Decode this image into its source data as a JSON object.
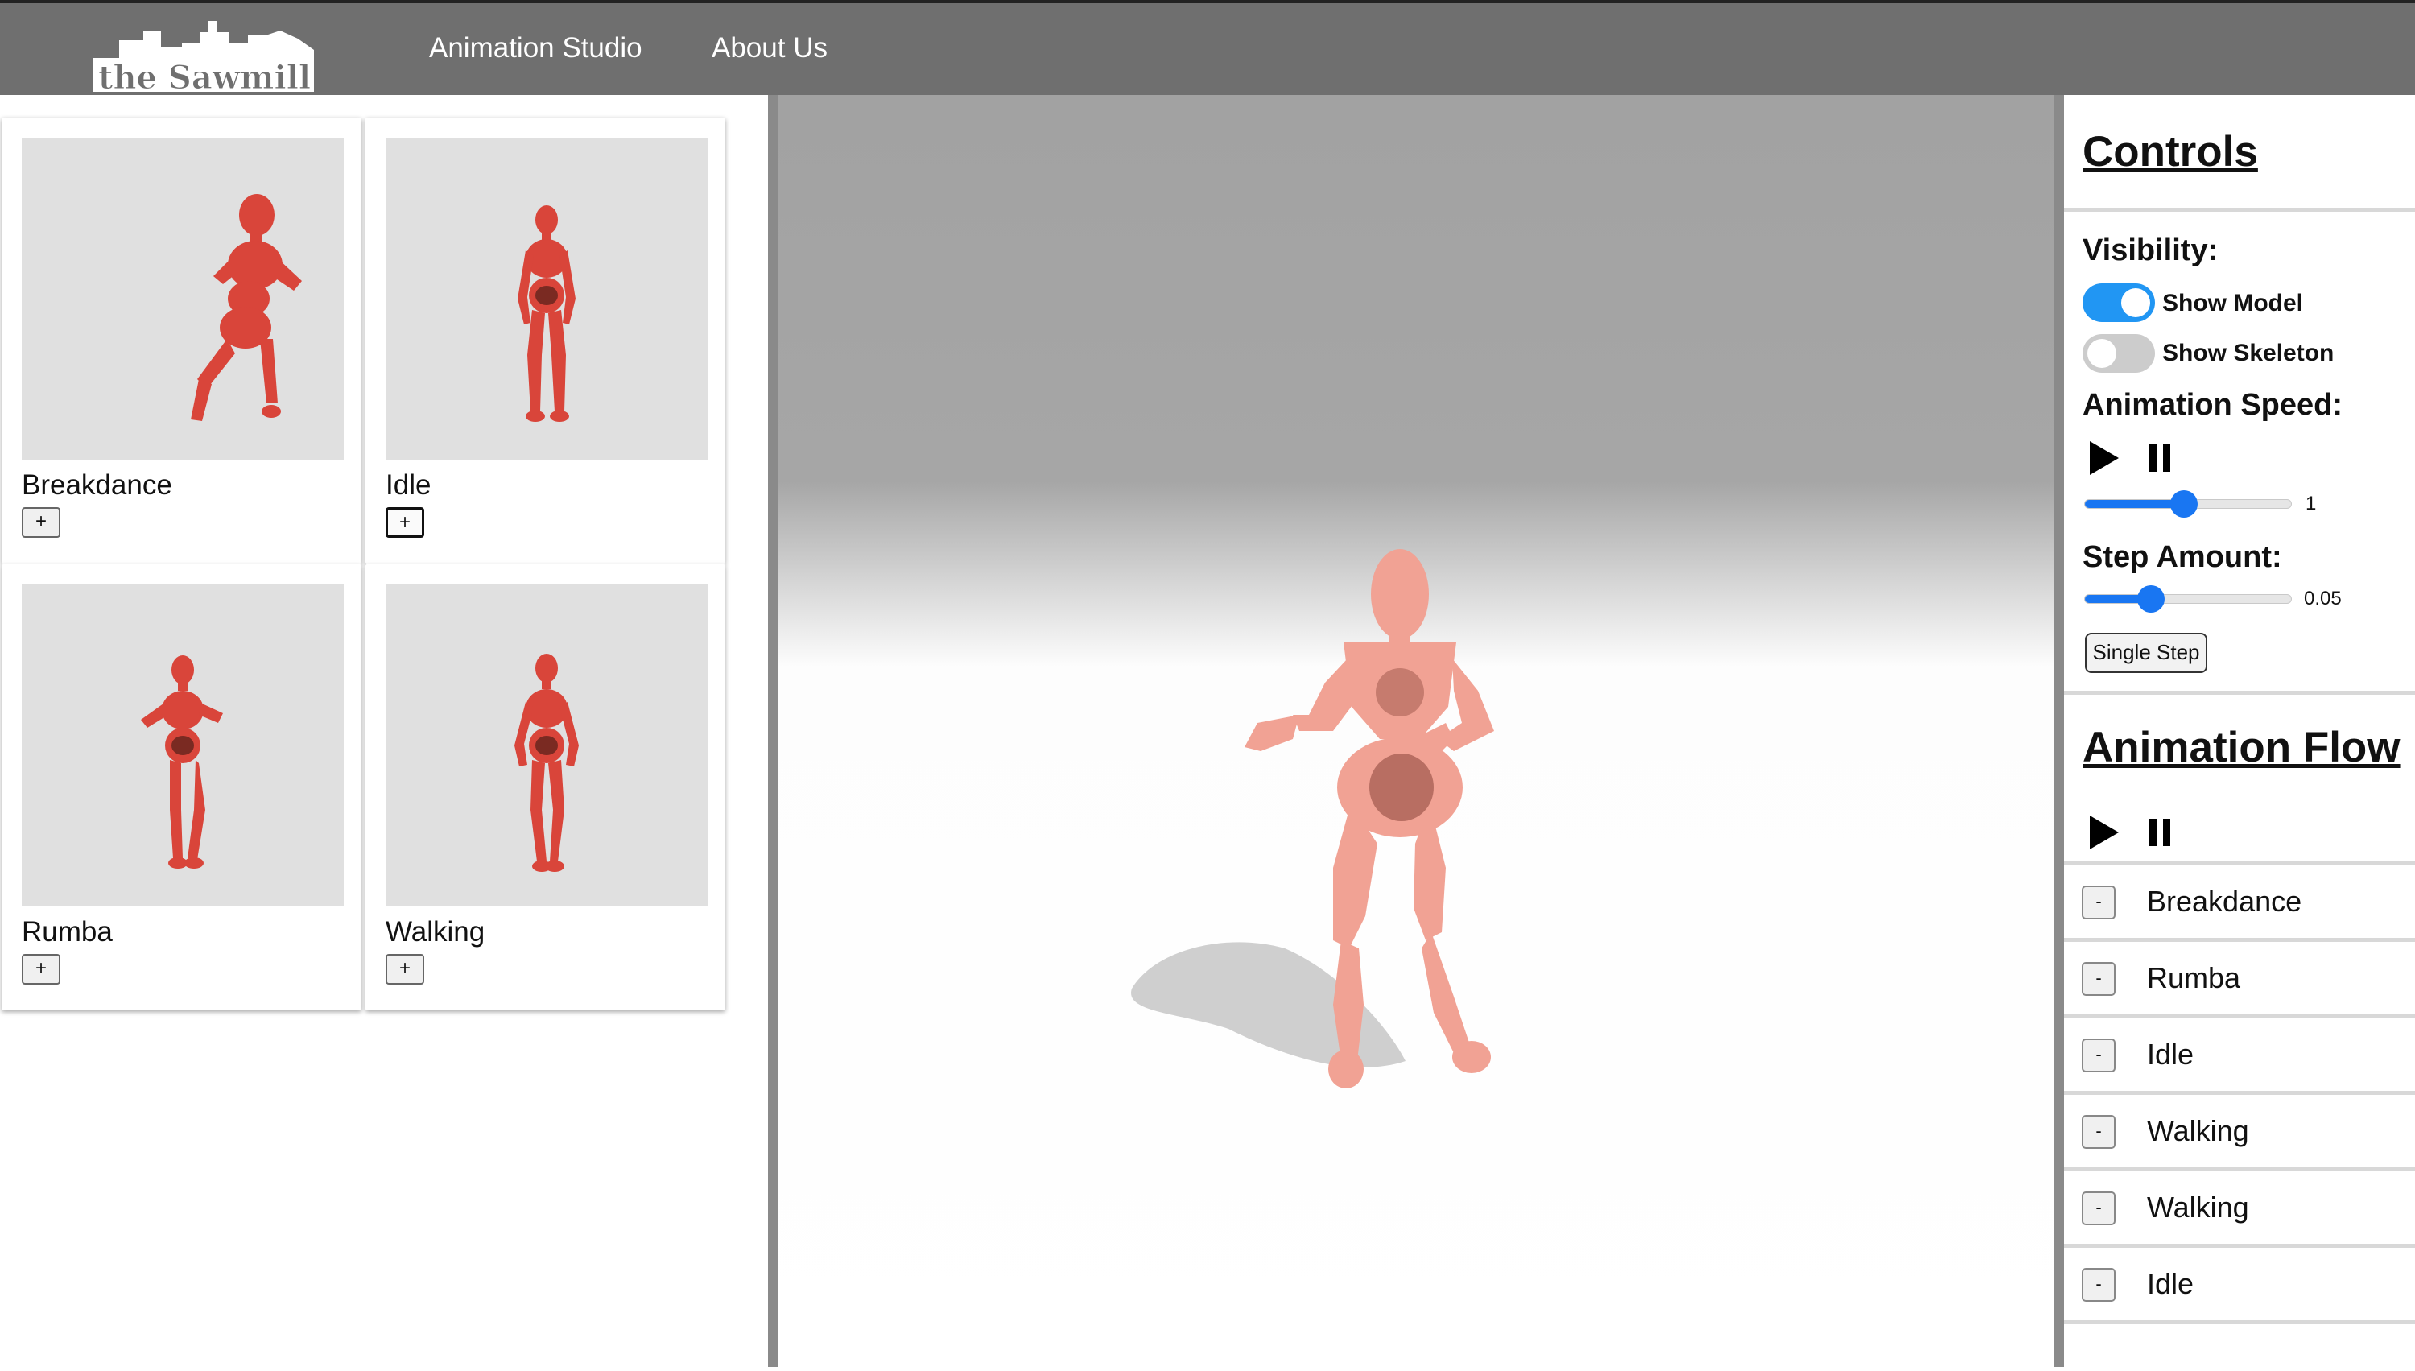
{
  "header": {
    "logo_text": "the Sawmill",
    "nav": [
      "Animation Studio",
      "About Us"
    ]
  },
  "library": {
    "cards": [
      {
        "name": "Breakdance",
        "add_label": "+"
      },
      {
        "name": "Idle",
        "add_label": "+"
      },
      {
        "name": "Rumba",
        "add_label": "+"
      },
      {
        "name": "Walking",
        "add_label": "+"
      }
    ]
  },
  "controls": {
    "title": "Controls",
    "visibility_label": "Visibility:",
    "show_model_label": "Show Model",
    "show_model_on": true,
    "show_skeleton_label": "Show Skeleton",
    "show_skeleton_on": false,
    "speed_label": "Animation Speed:",
    "speed_value": "1",
    "speed_fraction": 0.48,
    "step_label": "Step Amount:",
    "step_value": "0.05",
    "step_fraction": 0.32,
    "single_step_label": "Single Step"
  },
  "flow": {
    "title": "Animation Flow",
    "items": [
      {
        "name": "Breakdance",
        "remove_label": "-"
      },
      {
        "name": "Rumba",
        "remove_label": "-"
      },
      {
        "name": "Idle",
        "remove_label": "-"
      },
      {
        "name": "Walking",
        "remove_label": "-"
      },
      {
        "name": "Walking",
        "remove_label": "-"
      },
      {
        "name": "Idle",
        "remove_label": "-"
      }
    ]
  },
  "colors": {
    "header_bg": "#6f6f6f",
    "accent_blue": "#2196f3",
    "thumb_model": "#d9453a",
    "main_model": "#f1a294"
  }
}
